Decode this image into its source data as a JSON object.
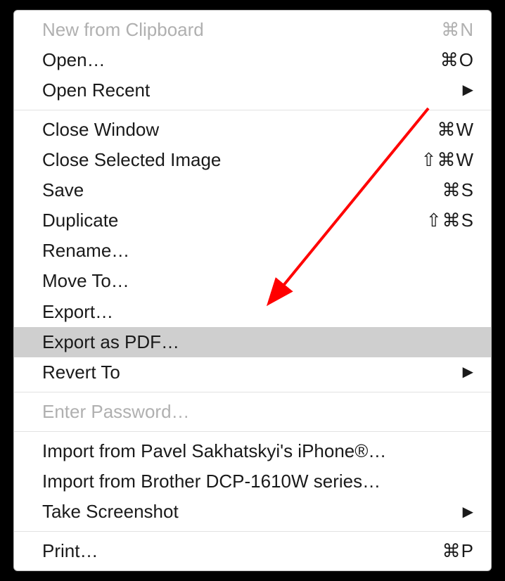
{
  "menu": {
    "groups": [
      [
        {
          "id": "new-from-clipboard",
          "label": "New from Clipboard",
          "shortcut": "⌘N",
          "disabled": true,
          "submenu": false,
          "highlighted": false
        },
        {
          "id": "open",
          "label": "Open…",
          "shortcut": "⌘O",
          "disabled": false,
          "submenu": false,
          "highlighted": false
        },
        {
          "id": "open-recent",
          "label": "Open Recent",
          "shortcut": "",
          "disabled": false,
          "submenu": true,
          "highlighted": false
        }
      ],
      [
        {
          "id": "close-window",
          "label": "Close Window",
          "shortcut": "⌘W",
          "disabled": false,
          "submenu": false,
          "highlighted": false
        },
        {
          "id": "close-selected-image",
          "label": "Close Selected Image",
          "shortcut": "⇧⌘W",
          "disabled": false,
          "submenu": false,
          "highlighted": false
        },
        {
          "id": "save",
          "label": "Save",
          "shortcut": "⌘S",
          "disabled": false,
          "submenu": false,
          "highlighted": false
        },
        {
          "id": "duplicate",
          "label": "Duplicate",
          "shortcut": "⇧⌘S",
          "disabled": false,
          "submenu": false,
          "highlighted": false
        },
        {
          "id": "rename",
          "label": "Rename…",
          "shortcut": "",
          "disabled": false,
          "submenu": false,
          "highlighted": false
        },
        {
          "id": "move-to",
          "label": "Move To…",
          "shortcut": "",
          "disabled": false,
          "submenu": false,
          "highlighted": false
        },
        {
          "id": "export",
          "label": "Export…",
          "shortcut": "",
          "disabled": false,
          "submenu": false,
          "highlighted": false
        },
        {
          "id": "export-as-pdf",
          "label": "Export as PDF…",
          "shortcut": "",
          "disabled": false,
          "submenu": false,
          "highlighted": true
        },
        {
          "id": "revert-to",
          "label": "Revert To",
          "shortcut": "",
          "disabled": false,
          "submenu": true,
          "highlighted": false
        }
      ],
      [
        {
          "id": "enter-password",
          "label": "Enter Password…",
          "shortcut": "",
          "disabled": true,
          "submenu": false,
          "highlighted": false
        }
      ],
      [
        {
          "id": "import-iphone",
          "label": "Import from Pavel Sakhatskyi's iPhone®…",
          "shortcut": "",
          "disabled": false,
          "submenu": false,
          "highlighted": false
        },
        {
          "id": "import-brother",
          "label": "Import from Brother DCP-1610W series…",
          "shortcut": "",
          "disabled": false,
          "submenu": false,
          "highlighted": false
        },
        {
          "id": "take-screenshot",
          "label": "Take Screenshot",
          "shortcut": "",
          "disabled": false,
          "submenu": true,
          "highlighted": false
        }
      ],
      [
        {
          "id": "print",
          "label": "Print…",
          "shortcut": "⌘P",
          "disabled": false,
          "submenu": false,
          "highlighted": false
        }
      ]
    ]
  },
  "annotation": {
    "type": "arrow",
    "color": "#ff0000"
  }
}
